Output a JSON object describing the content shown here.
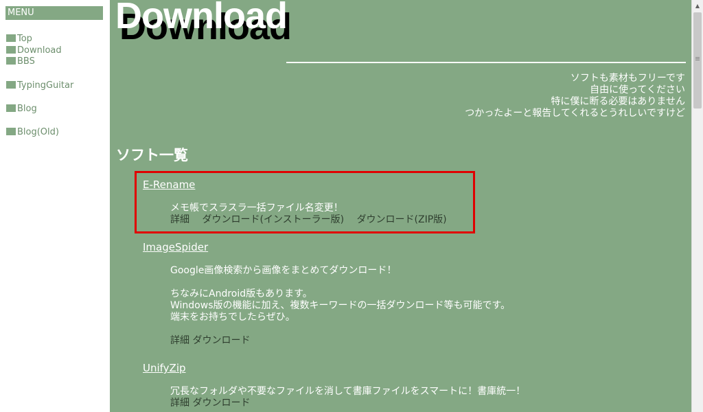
{
  "sidebar": {
    "menu_title": "MENU",
    "items": [
      {
        "label": "Top"
      },
      {
        "label": "Download"
      },
      {
        "label": "BBS"
      },
      {
        "label": "TypingGuitar"
      },
      {
        "label": "Blog"
      },
      {
        "label": "Blog(Old)"
      }
    ]
  },
  "page": {
    "title": "Download",
    "intro": [
      "ソフトも素材もフリーです",
      "自由に使ってください",
      "特に僕に断る必要はありません",
      "つかったよーと報告してくれるとうれしいですけど"
    ],
    "section_title": "ソフト一覧"
  },
  "software": [
    {
      "name": "E-Rename",
      "description": [
        "メモ帳でスラスラ一括ファイル名変更！"
      ],
      "links": [
        "詳細",
        "ダウンロード(インストーラー版)",
        "ダウンロード(ZIP版)"
      ]
    },
    {
      "name": "ImageSpider",
      "description": [
        "Google画像検索から画像をまとめてダウンロード！",
        "",
        "ちなみにAndroid版もあります。",
        "Windows版の機能に加え、複数キーワードの一括ダウンロード等も可能です。",
        "端末をお持ちでしたらぜひ。"
      ],
      "links": [
        "詳細",
        "ダウンロード"
      ]
    },
    {
      "name": "UnifyZip",
      "description": [
        "冗長なフォルダや不要なファイルを消して書庫ファイルをスマートに！書庫統一！"
      ],
      "links": [
        "詳細",
        "ダウンロード"
      ]
    }
  ],
  "colors": {
    "background": "#84a884",
    "highlight": "#e00000",
    "text": "#ffffff"
  }
}
